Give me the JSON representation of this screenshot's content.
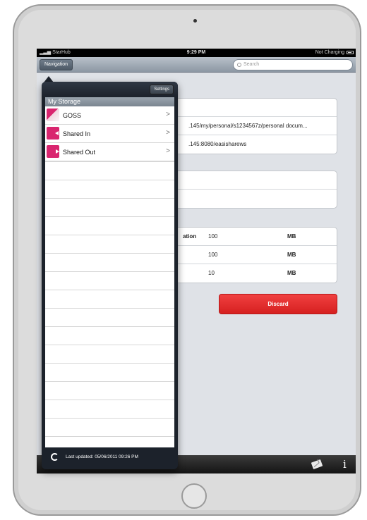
{
  "status_bar": {
    "carrier": "StarHub",
    "time": "9:29 PM",
    "battery": "Not Charging"
  },
  "nav_bar": {
    "navigation_label": "Navigation",
    "search_placeholder": "Search"
  },
  "main": {
    "paths": [
      ".145/my/personal/s1234567z/personal docum...",
      ".145:8080/easisharews"
    ],
    "quota_rows": [
      {
        "label": "ation",
        "value": "100",
        "unit": "MB"
      },
      {
        "label": "",
        "value": "100",
        "unit": "MB"
      },
      {
        "label": "",
        "value": "10",
        "unit": "MB"
      }
    ],
    "discard_label": "Discard"
  },
  "popover": {
    "settings_label": "Settings",
    "section_title": "My Storage",
    "items": [
      {
        "label": "GOSS",
        "icon": "goss-storage-icon"
      },
      {
        "label": "Shared In",
        "icon": "shared-in-icon"
      },
      {
        "label": "Shared Out",
        "icon": "shared-out-icon"
      }
    ],
    "last_updated": "Last updated: 05/06/2011 09:26 PM"
  },
  "colors": {
    "accent_red": "#e02d2d",
    "brand_pink": "#d9256f"
  }
}
